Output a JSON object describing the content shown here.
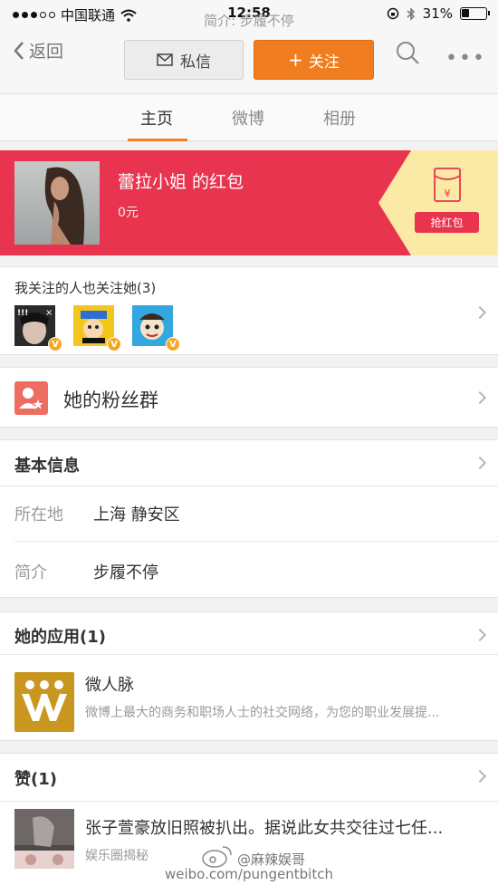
{
  "status_bar": {
    "carrier": "中国联通",
    "time": "12:58",
    "battery": "31%",
    "battery_level": 0.31
  },
  "intro_overlay": "简介: 步履不停",
  "nav": {
    "back_label": "返回",
    "message_label": "私信",
    "follow_label": "关注"
  },
  "tabs": [
    {
      "label": "主页",
      "active": true
    },
    {
      "label": "微博",
      "active": false
    },
    {
      "label": "相册",
      "active": false
    }
  ],
  "red_envelope": {
    "title": "蕾拉小姐 的红包",
    "amount": "0元",
    "grab_label": "抢红包",
    "colors": {
      "banner": "#e8344e",
      "tag": "#fbe9a6"
    }
  },
  "mutual_follow": {
    "label": "我关注的人也关注她(3)",
    "avatars": [
      "avatar-1",
      "avatar-2",
      "avatar-3"
    ]
  },
  "fans_group": {
    "label": "她的粉丝群"
  },
  "basic_info": {
    "header": "基本信息",
    "rows": [
      {
        "key": "所在地",
        "value": "上海 静安区"
      },
      {
        "key": "简介",
        "value": "步履不停"
      }
    ]
  },
  "apps": {
    "header": "她的应用(1)",
    "items": [
      {
        "name": "微人脉",
        "desc": "微博上最大的商务和职场人士的社交网络，为您的职业发展提..."
      }
    ]
  },
  "likes": {
    "header": "赞(1)",
    "items": [
      {
        "text": "张子萱豪放旧照被扒出。据说此女共交往过七任...",
        "source": "娱乐圈揭秘"
      }
    ]
  },
  "watermark": {
    "name": "@麻辣娱哥",
    "url": "weibo.com/pungentbitch"
  },
  "accent_color": "#f07d1f"
}
